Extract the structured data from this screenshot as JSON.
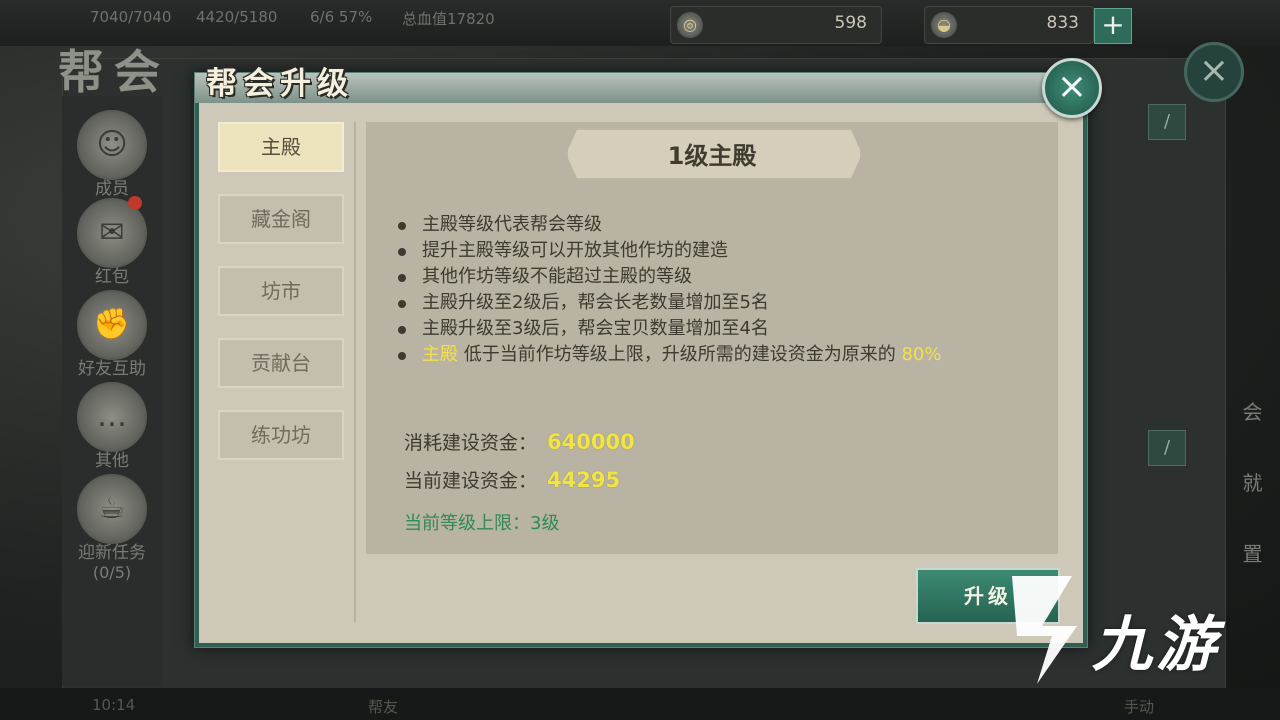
{
  "resources": {
    "stats": [
      "7040/7040",
      "4420/5180",
      "6/6  57%",
      "总血值17820"
    ],
    "jade": "598",
    "gold": "833",
    "plus": "+"
  },
  "background": {
    "title": "帮会",
    "close": "×",
    "nav": [
      {
        "label": "成员",
        "icon": "member-icon"
      },
      {
        "label": "红包",
        "icon": "red-packet-icon"
      },
      {
        "label": "好友互助",
        "icon": "handshake-icon"
      },
      {
        "label": "其他",
        "icon": "scroll-icon"
      },
      {
        "label": "迎新任务",
        "sub": "(0/5)",
        "icon": "task-icon"
      }
    ],
    "right_labels": [
      "会",
      "就",
      "置"
    ],
    "bottom": [
      "10:14",
      "帮友",
      "手动"
    ]
  },
  "modal": {
    "title": "帮会升级",
    "close": "×",
    "tabs": [
      "主殿",
      "藏金阁",
      "坊市",
      "贡献台",
      "练功坊"
    ],
    "active_tab": 0,
    "heading": "1级主殿",
    "desc": [
      "主殿等级代表帮会等级",
      "提升主殿等级可以开放其他作坊的建造",
      "其他作坊等级不能超过主殿的等级",
      "主殿升级至2级后，帮会长老数量增加至5名",
      "主殿升级至3级后，帮会宝贝数量增加至4名"
    ],
    "note": {
      "hl1": "主殿",
      "text": " 低于当前作坊等级上限，升级所需的建设资金为原来的 ",
      "hl2": "80%"
    },
    "cost_label": "消耗建设资金：",
    "cost_value": "640000",
    "current_label": "当前建设资金：",
    "current_value": "44295",
    "limit": "当前等级上限：3级",
    "upgrade": "升级"
  },
  "watermark": "九游",
  "colors": {
    "accent": "#2f6b5a",
    "highlight": "#f5e04a",
    "limit_text": "#2f8a5a"
  }
}
